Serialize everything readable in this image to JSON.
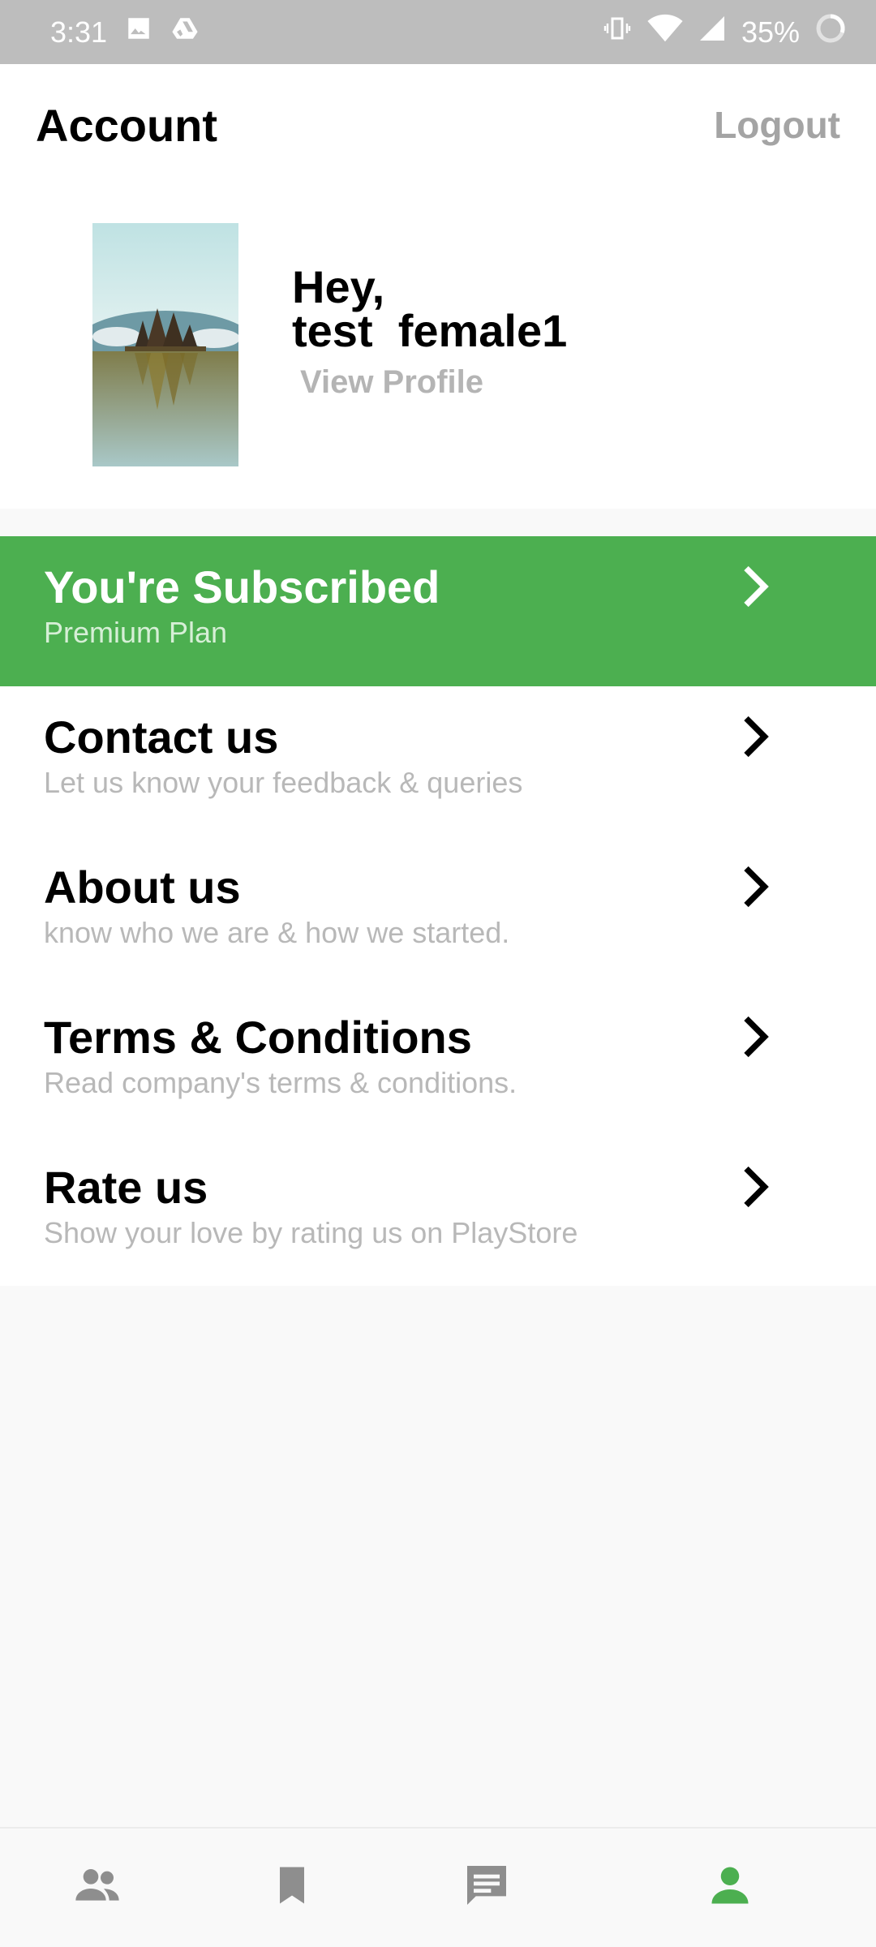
{
  "status_bar": {
    "time": "3:31",
    "battery": "35%",
    "icons": [
      "image-icon",
      "drive-icon",
      "vibrate-icon",
      "wifi-icon",
      "signal-icon",
      "battery-ring-icon"
    ]
  },
  "header": {
    "title": "Account",
    "logout_label": "Logout"
  },
  "profile": {
    "greeting_line1": "Hey,",
    "greeting_line2": "test  female1",
    "view_profile_label": "View Profile"
  },
  "menu": {
    "items": [
      {
        "title": "You're Subscribed",
        "subtitle": "Premium Plan"
      },
      {
        "title": "Contact us",
        "subtitle": "Let us know your feedback & queries"
      },
      {
        "title": "About us",
        "subtitle": "know who we are & how we started."
      },
      {
        "title": "Terms & Conditions",
        "subtitle": "Read company's terms & conditions."
      },
      {
        "title": "Rate us",
        "subtitle": "Show your love by rating us on PlayStore"
      }
    ]
  },
  "bottom_nav": {
    "items": [
      {
        "icon": "people-icon",
        "active": false
      },
      {
        "icon": "bookmark-icon",
        "active": false
      },
      {
        "icon": "chat-icon",
        "active": false
      },
      {
        "icon": "person-icon",
        "active": true
      }
    ]
  },
  "colors": {
    "accent": "#4caf50",
    "status_bar": "#bdbdbd",
    "muted_text": "#b8b8b8",
    "inactive_icon": "#8e8e8e"
  }
}
